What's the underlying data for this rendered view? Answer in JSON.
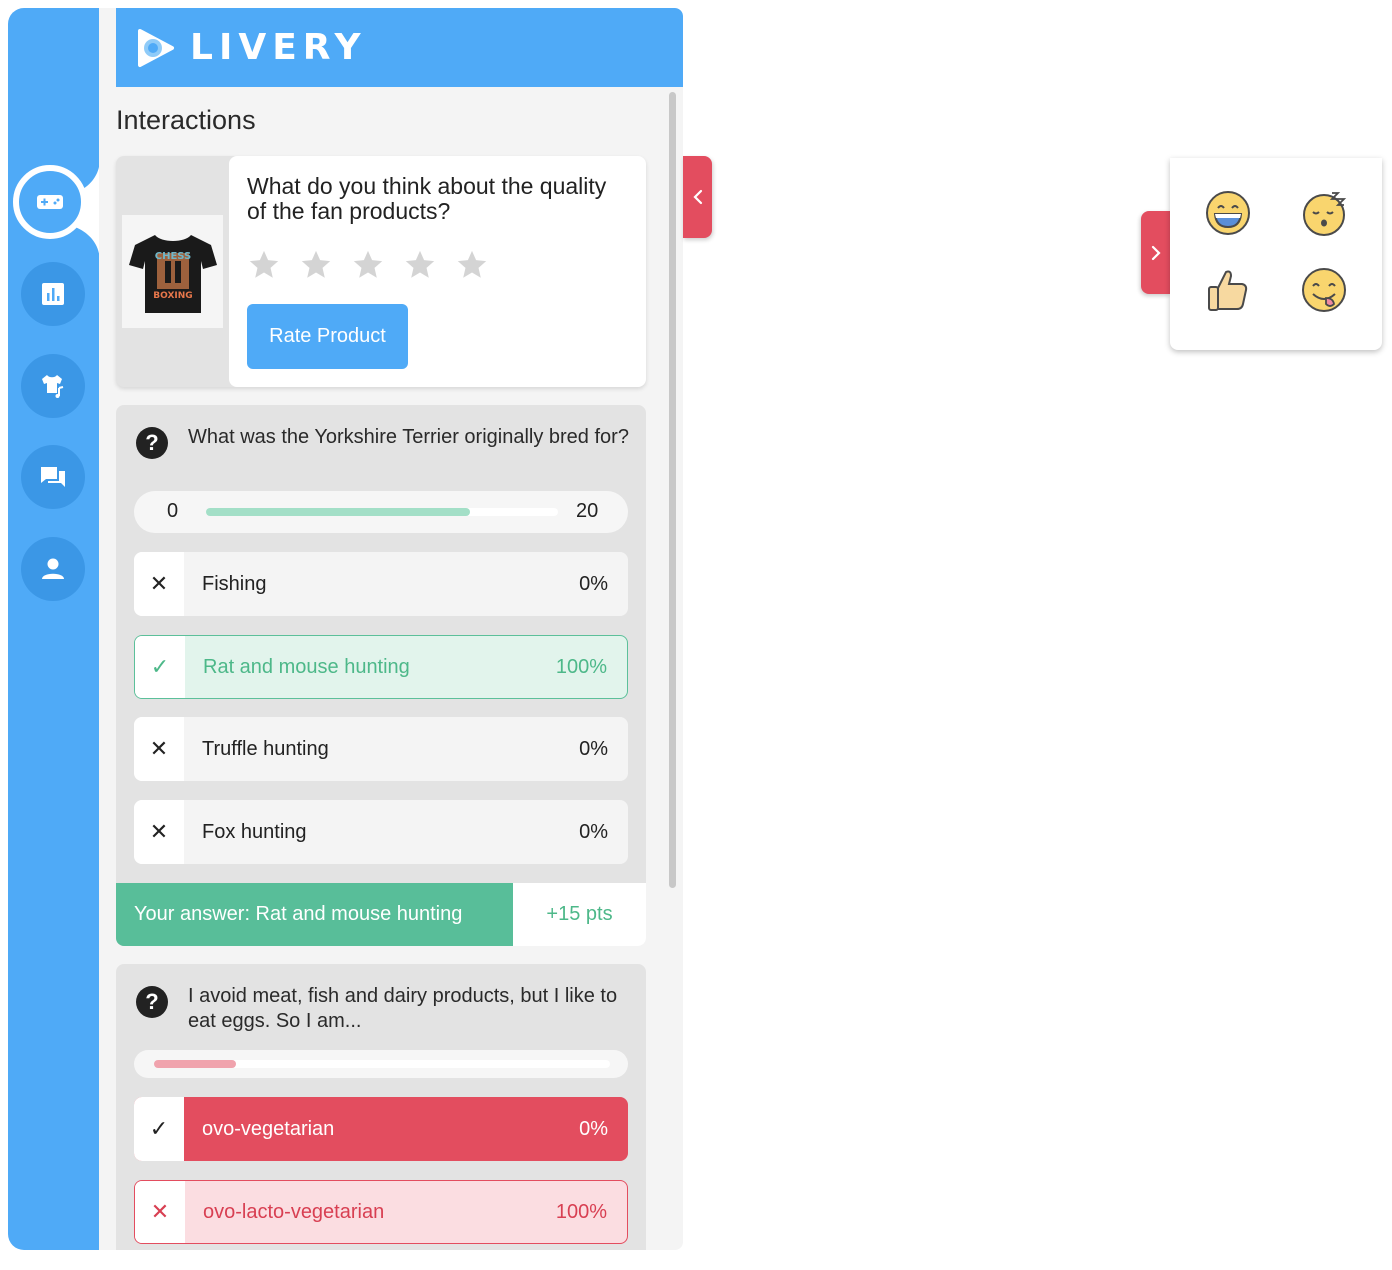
{
  "brand": {
    "name": "LIVERY"
  },
  "section_title": "Interactions",
  "rail": {
    "items": [
      {
        "icon": "gamepad-icon",
        "active": true
      },
      {
        "icon": "bar-chart-icon",
        "active": false
      },
      {
        "icon": "merch-icon",
        "active": false
      },
      {
        "icon": "chat-icon",
        "active": false
      },
      {
        "icon": "user-icon",
        "active": false
      }
    ]
  },
  "product_rating": {
    "question": "What do you think about the quality of the fan products?",
    "product_image_text": [
      "CHESS",
      "BOXING"
    ],
    "stars": 5,
    "rating": 0,
    "button_label": "Rate Product"
  },
  "quiz1": {
    "question": "What was the Yorkshire Terrier originally bred for?",
    "timer_min": "0",
    "timer_max": "20",
    "timer_progress": 0.75,
    "options": [
      {
        "label": "Fishing",
        "percent": "0%",
        "state": "wrong"
      },
      {
        "label": "Rat and mouse hunting",
        "percent": "100%",
        "state": "correct"
      },
      {
        "label": "Truffle hunting",
        "percent": "0%",
        "state": "wrong"
      },
      {
        "label": "Fox hunting",
        "percent": "0%",
        "state": "wrong"
      }
    ],
    "answer_text": "Your answer: Rat and mouse hunting",
    "points": "+15 pts"
  },
  "quiz2": {
    "question": "I avoid meat, fish and dairy products, but I like to eat eggs. So I am...",
    "timer_progress": 0.18,
    "options": [
      {
        "label": "ovo-vegetarian",
        "percent": "0%",
        "state": "selected-wrong"
      },
      {
        "label": "ovo-lacto-vegetarian",
        "percent": "100%",
        "state": "wrong-correct"
      }
    ]
  },
  "reactions": [
    "grinning-face-icon",
    "sleeping-face-icon",
    "thumbs-up-icon",
    "tongue-face-icon"
  ],
  "colors": {
    "primary": "#4faaf7",
    "accent_red": "#e34d5f",
    "success": "#58be99",
    "timer_green": "#a3dfc7",
    "timer_red": "#f0a3ad"
  }
}
